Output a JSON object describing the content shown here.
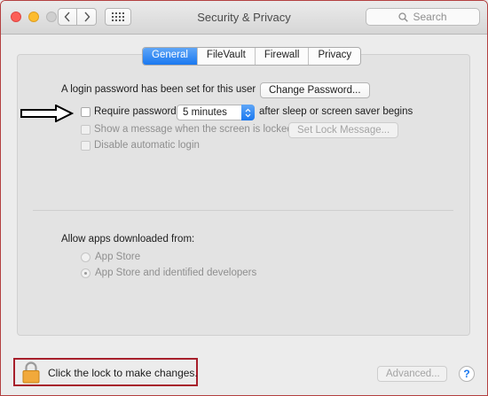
{
  "window": {
    "title": "Security & Privacy",
    "search_placeholder": "Search"
  },
  "tabs": [
    {
      "label": "General",
      "active": true
    },
    {
      "label": "FileVault",
      "active": false
    },
    {
      "label": "Firewall",
      "active": false
    },
    {
      "label": "Privacy",
      "active": false
    }
  ],
  "general": {
    "login_password_text": "A login password has been set for this user",
    "change_password_label": "Change Password...",
    "require_password_label": "Require password",
    "require_password_checked": false,
    "require_password_delay": "5 minutes",
    "after_sleep_text": "after sleep or screen saver begins",
    "show_message_label": "Show a message when the screen is locked",
    "set_lock_message_label": "Set Lock Message...",
    "disable_auto_login_label": "Disable automatic login"
  },
  "downloads": {
    "heading": "Allow apps downloaded from:",
    "options": [
      {
        "label": "App Store",
        "selected": false
      },
      {
        "label": "App Store and identified developers",
        "selected": true
      }
    ]
  },
  "footer": {
    "lock_text": "Click the lock to make changes.",
    "advanced_label": "Advanced...",
    "help_label": "?"
  },
  "colors": {
    "accent": "#1a78f0",
    "annotation_box": "#a71f2b",
    "lock_body": "#f1a93b"
  },
  "icons": {
    "back": "chevron-left-icon",
    "forward": "chevron-right-icon",
    "show_all": "grid-icon",
    "search": "search-icon",
    "lock": "lock-icon",
    "annotation": "arrow-right-icon"
  }
}
